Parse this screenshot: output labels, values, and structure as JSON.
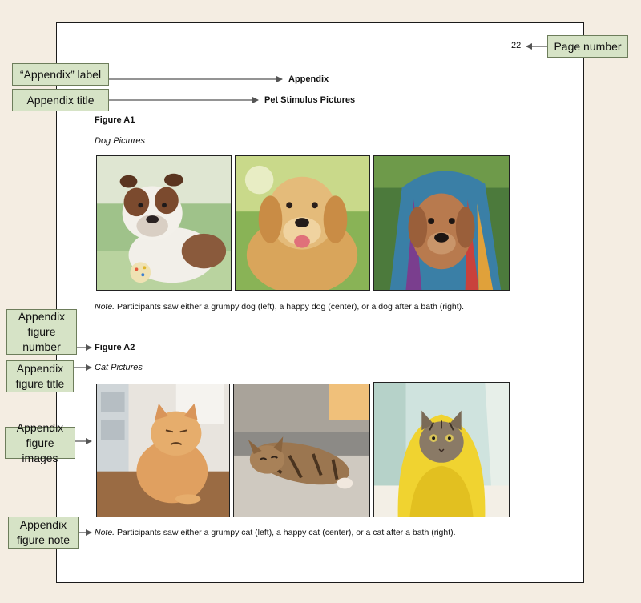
{
  "page": {
    "page_number": "22",
    "appendix_label": "Appendix",
    "appendix_title": "Pet Stimulus Pictures"
  },
  "figure_a1": {
    "number": "Figure A1",
    "title": "Dog Pictures",
    "images": [
      "grumpy dog",
      "happy dog",
      "dog after a bath"
    ],
    "note_label": "Note.",
    "note_text": " Participants saw either a grumpy dog (left), a happy dog (center), or a dog after a bath (right)."
  },
  "figure_a2": {
    "number": "Figure A2",
    "title": "Cat Pictures",
    "images": [
      "grumpy cat",
      "happy cat",
      "cat after a bath"
    ],
    "note_label": "Note.",
    "note_text": " Participants saw either a grumpy cat (left), a happy cat (center), or a cat after a bath (right)."
  },
  "callouts": {
    "page_number": "Page number",
    "appendix_label": "“Appendix” label",
    "appendix_title": "Appendix title",
    "figure_number": "Appendix figure number",
    "figure_title": "Appendix figure title",
    "figure_images": "Appendix figure images",
    "figure_note": "Appendix figure note"
  },
  "colors": {
    "background": "#f4ede2",
    "callout_fill": "#d6e3c6",
    "callout_border": "#6d7d5b",
    "arrow": "#555555"
  }
}
